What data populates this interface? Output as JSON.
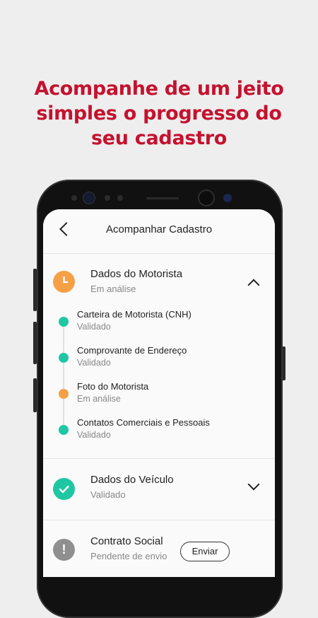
{
  "headline": {
    "line1": "Acompanhe de um jeito",
    "line2": "simples o progresso do",
    "line3": "seu cadastro"
  },
  "colors": {
    "brand": "#c4122f",
    "pending": "#f5a046",
    "validated": "#1ec7a2",
    "alert": "#8f8f8f"
  },
  "appbar": {
    "title": "Acompanhar Cadastro",
    "back_icon": "chevron-left-icon"
  },
  "driver": {
    "title": "Dados do Motorista",
    "status": "Em análise",
    "icon": "clock-icon",
    "items": [
      {
        "title": "Carteira de Motorista (CNH)",
        "status": "Validado"
      },
      {
        "title": "Comprovante de Endereço",
        "status": "Validado"
      },
      {
        "title": "Foto do Motorista",
        "status": "Em análise"
      },
      {
        "title": "Contatos Comerciais e Pessoais",
        "status": "Validado"
      }
    ]
  },
  "vehicle": {
    "title": "Dados do Veículo",
    "status": "Validado",
    "icon": "check-icon"
  },
  "contract": {
    "title": "Contrato Social",
    "status": "Pendente de envio",
    "icon": "exclamation-icon",
    "button": "Enviar"
  }
}
